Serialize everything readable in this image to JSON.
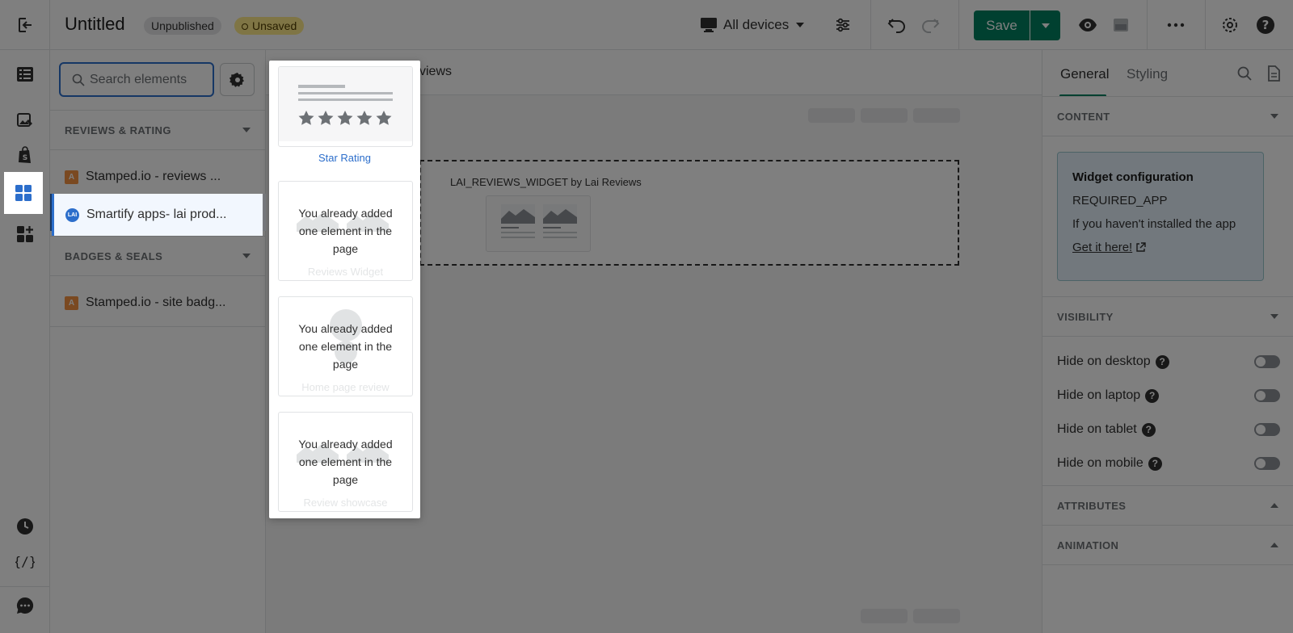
{
  "header": {
    "title": "Untitled",
    "badge_unpublished": "Unpublished",
    "badge_unsaved": "Unsaved",
    "devices_label": "All devices",
    "save_label": "Save"
  },
  "search": {
    "placeholder": "Search elements"
  },
  "elements_panel": {
    "sections": [
      {
        "title": "REVIEWS & RATING",
        "items": [
          "Stamped.io - reviews ...",
          "Smartify apps- lai prod..."
        ]
      },
      {
        "title": "BADGES & SEALS",
        "items": [
          "Stamped.io - site badg..."
        ]
      }
    ]
  },
  "flyout": {
    "cards": [
      {
        "label": "Star Rating",
        "message": ""
      },
      {
        "label": "Reviews Widget",
        "message": "You already added one element in the page"
      },
      {
        "label": "Home page review",
        "message": "You already added one element in the page"
      },
      {
        "label": "Review showcase",
        "message": "You already added one element in the page"
      }
    ]
  },
  "canvas": {
    "crumb": "views",
    "widget_title": "LAI_REVIEWS_WIDGET by Lai Reviews"
  },
  "right_panel": {
    "tabs": [
      "General",
      "Styling"
    ],
    "sections": {
      "content": "CONTENT",
      "visibility": "VISIBILITY",
      "attributes": "ATTRIBUTES",
      "animation": "ANIMATION"
    },
    "config": {
      "title": "Widget configuration",
      "code": "REQUIRED_APP",
      "note": "If you haven't installed the app",
      "link": "Get it here!"
    },
    "toggles": [
      "Hide on desktop",
      "Hide on laptop",
      "Hide on tablet",
      "Hide on mobile"
    ]
  },
  "colors": {
    "accent": "#008060",
    "selection": "#2c6ecb",
    "unsaved_badge": "#ffea8a"
  }
}
